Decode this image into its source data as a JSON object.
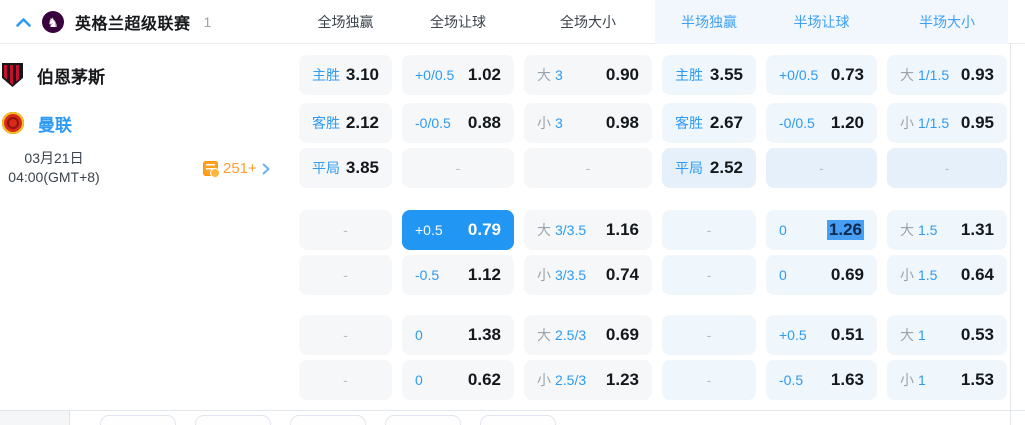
{
  "league": {
    "name": "英格兰超级联赛",
    "count": "1"
  },
  "columns": [
    {
      "label": "全场独赢"
    },
    {
      "label": "全场让球"
    },
    {
      "label": "全场大小"
    },
    {
      "label": "半场独赢",
      "half": true
    },
    {
      "label": "半场让球",
      "half": true
    },
    {
      "label": "半场大小",
      "half": true
    }
  ],
  "teams": {
    "home": "伯恩茅斯",
    "away": "曼联"
  },
  "match_time": {
    "date": "03月21日",
    "time": "04:00(GMT+8)"
  },
  "more_markets": {
    "count": "251+"
  },
  "rows": [
    {
      "cells": [
        {
          "label": "主胜",
          "value": "3.10"
        },
        {
          "label": "+0/0.5",
          "value": "1.02"
        },
        {
          "prefix": "大",
          "label": "3",
          "value": "0.90"
        },
        {
          "label": "主胜",
          "value": "3.55"
        },
        {
          "label": "+0/0.5",
          "value": "0.73"
        },
        {
          "prefix": "大",
          "label": "1/1.5",
          "value": "0.93"
        }
      ]
    },
    {
      "cells": [
        {
          "label": "客胜",
          "value": "2.12"
        },
        {
          "label": "-0/0.5",
          "value": "0.88"
        },
        {
          "prefix": "小",
          "label": "3",
          "value": "0.98"
        },
        {
          "label": "客胜",
          "value": "2.67"
        },
        {
          "label": "-0/0.5",
          "value": "1.20"
        },
        {
          "prefix": "小",
          "label": "1/1.5",
          "value": "0.95"
        }
      ]
    },
    {
      "cells": [
        {
          "label": "平局",
          "value": "3.85"
        },
        {
          "dash": true
        },
        {
          "dash": true
        },
        {
          "label": "平局",
          "value": "2.52",
          "tinted": true
        },
        {
          "dash": true,
          "tinted": true
        },
        {
          "dash": true,
          "tinted": true
        }
      ]
    },
    {
      "cells": [
        {
          "dash": true
        },
        {
          "label": "+0.5",
          "value": "0.79",
          "selected": true
        },
        {
          "prefix": "大",
          "label": "3/3.5",
          "value": "1.16"
        },
        {
          "dash": true
        },
        {
          "label": "0",
          "value": "1.26",
          "hl": true
        },
        {
          "prefix": "大",
          "label": "1.5",
          "value": "1.31"
        }
      ]
    },
    {
      "cells": [
        {
          "dash": true
        },
        {
          "label": "-0.5",
          "value": "1.12"
        },
        {
          "prefix": "小",
          "label": "3/3.5",
          "value": "0.74"
        },
        {
          "dash": true
        },
        {
          "label": "0",
          "value": "0.69"
        },
        {
          "prefix": "小",
          "label": "1.5",
          "value": "0.64"
        }
      ]
    },
    {
      "cells": [
        {
          "dash": true
        },
        {
          "label": "0",
          "value": "1.38"
        },
        {
          "prefix": "大",
          "label": "2.5/3",
          "value": "0.69"
        },
        {
          "dash": true
        },
        {
          "label": "+0.5",
          "value": "0.51"
        },
        {
          "prefix": "大",
          "label": "1",
          "value": "0.53"
        }
      ]
    },
    {
      "cells": [
        {
          "dash": true
        },
        {
          "label": "0",
          "value": "0.62"
        },
        {
          "prefix": "小",
          "label": "2.5/3",
          "value": "1.23"
        },
        {
          "dash": true
        },
        {
          "label": "-0.5",
          "value": "1.63"
        },
        {
          "prefix": "小",
          "label": "1",
          "value": "1.53"
        }
      ]
    }
  ],
  "colors": {
    "accent_blue": "#2d9bf3",
    "selected_cell_bg": "#2196f3",
    "value_highlight_bg": "#469ff2",
    "value_highlight_text": "#0e2a51",
    "cell_bg_full": "#f6f7f9",
    "cell_bg_half": "#eff6fc",
    "cell_bg_half_draw": "#e6f0fa",
    "orange": "#ff9d2e",
    "league_purple": "#38003c",
    "home_crest_red": "#c8102e",
    "away_crest_red": "#da291c"
  }
}
